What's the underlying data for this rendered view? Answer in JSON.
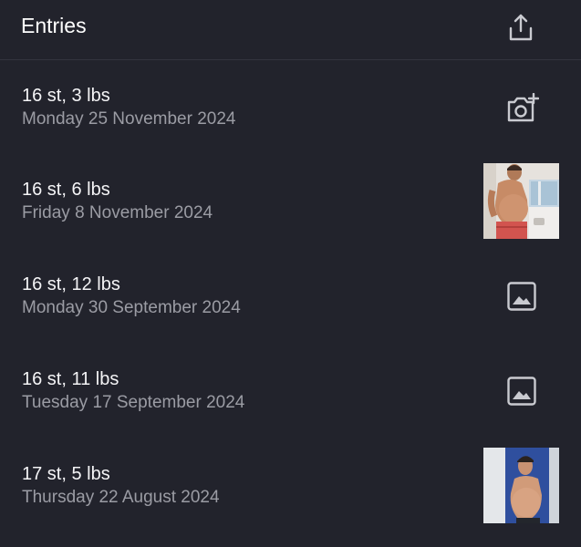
{
  "header": {
    "title": "Entries",
    "share_icon": "share-icon"
  },
  "entries": [
    {
      "weight": "16 st, 3 lbs",
      "date": "Monday 25 November 2024",
      "media": "add-photo-icon"
    },
    {
      "weight": "16 st, 6 lbs",
      "date": "Friday 8 November 2024",
      "media": "photo-thumbnail"
    },
    {
      "weight": "16 st, 12 lbs",
      "date": "Monday 30 September 2024",
      "media": "image-icon"
    },
    {
      "weight": "16 st, 11 lbs",
      "date": "Tuesday 17 September 2024",
      "media": "image-icon"
    },
    {
      "weight": "17 st, 5 lbs",
      "date": "Thursday 22 August 2024",
      "media": "photo-thumbnail"
    }
  ],
  "colors": {
    "background": "#22232c",
    "text_primary": "#f4f4f6",
    "text_secondary": "#9b9ca4",
    "icon": "#c9cad0"
  }
}
